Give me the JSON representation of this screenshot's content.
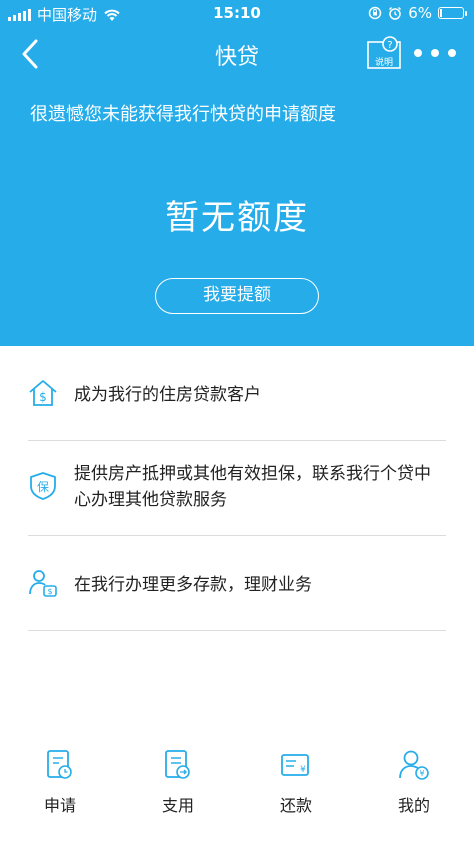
{
  "status_bar": {
    "carrier": "中国移动",
    "time": "15:10",
    "battery": "6%"
  },
  "nav": {
    "title": "快贷",
    "help_label": "说明"
  },
  "header": {
    "notice": "很遗憾您未能获得我行快贷的申请额度",
    "quota_text": "暂无额度",
    "raise_button": "我要提额"
  },
  "tips": [
    {
      "icon": "house-dollar-icon",
      "text": "成为我行的住房贷款客户"
    },
    {
      "icon": "shield-bao-icon",
      "text": "提供房产抵押或其他有效担保，联系我行个贷中心办理其他贷款服务"
    },
    {
      "icon": "user-money-icon",
      "text": "在我行办理更多存款，理财业务"
    }
  ],
  "tabbar": [
    {
      "label": "申请",
      "icon": "apply-icon"
    },
    {
      "label": "支用",
      "icon": "withdraw-icon"
    },
    {
      "label": "还款",
      "icon": "repay-icon"
    },
    {
      "label": "我的",
      "icon": "profile-icon"
    }
  ],
  "colors": {
    "brand_blue": "#26ade9",
    "text_dark": "#222222",
    "divider": "#dcdcdc"
  }
}
